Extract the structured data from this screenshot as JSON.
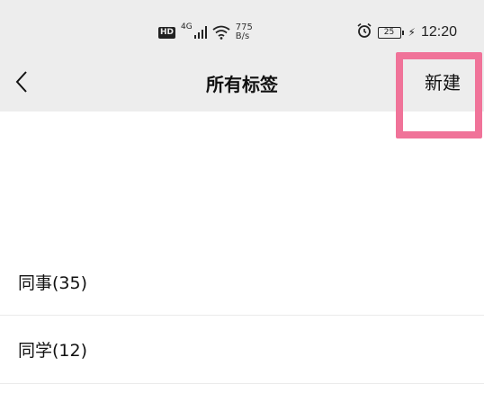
{
  "status_bar": {
    "hd": "HD",
    "network": "4G",
    "speed_value": "775",
    "speed_unit": "B/s",
    "battery": "25",
    "time": "12:20",
    "icons": [
      "hd-icon",
      "signal-icon",
      "wifi-icon",
      "alarm-icon",
      "battery-icon",
      "charging-icon"
    ]
  },
  "app_bar": {
    "title": "所有标签",
    "back_icon": "chevron-left-icon",
    "new_label": "新建"
  },
  "tags": [
    {
      "label": "同事(35)"
    },
    {
      "label": "同学(12)"
    }
  ],
  "colors": {
    "bar_background": "#ededed",
    "highlight": "#f07399",
    "text": "#111111"
  }
}
